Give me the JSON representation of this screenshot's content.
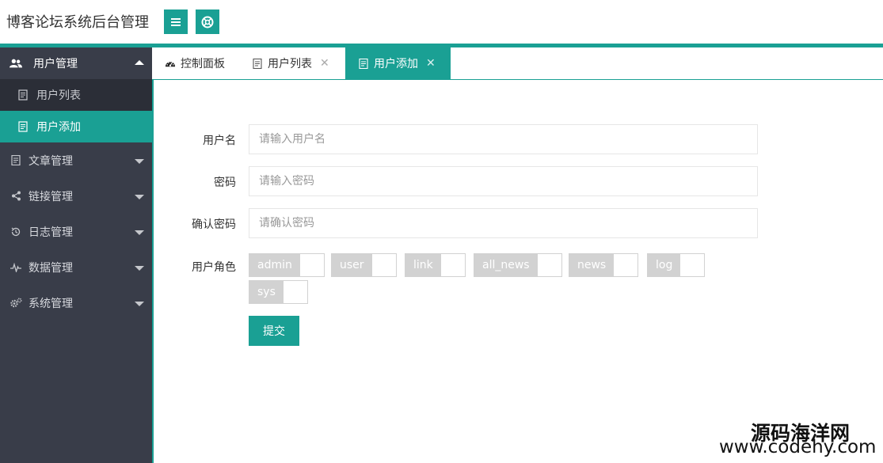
{
  "header": {
    "title": "博客论坛系统后台管理",
    "menu_icon": "menu-icon",
    "help_icon": "lifebuoy-icon"
  },
  "sidebar": {
    "groups": [
      {
        "label": "用户管理",
        "icon": "users-icon",
        "open": true,
        "items": [
          {
            "label": "用户列表",
            "icon": "document-icon",
            "active": false
          },
          {
            "label": "用户添加",
            "icon": "document-icon",
            "active": true
          }
        ]
      },
      {
        "label": "文章管理",
        "icon": "document-icon",
        "open": false
      },
      {
        "label": "链接管理",
        "icon": "share-icon",
        "open": false
      },
      {
        "label": "日志管理",
        "icon": "history-icon",
        "open": false
      },
      {
        "label": "数据管理",
        "icon": "pulse-icon",
        "open": false
      },
      {
        "label": "系统管理",
        "icon": "gears-icon",
        "open": false
      }
    ]
  },
  "tabs": [
    {
      "label": "控制面板",
      "icon": "dashboard-icon",
      "closable": false,
      "active": false
    },
    {
      "label": "用户列表",
      "icon": "document-icon",
      "closable": true,
      "active": false
    },
    {
      "label": "用户添加",
      "icon": "document-icon",
      "closable": true,
      "active": true
    }
  ],
  "tab_close_glyph": "✕",
  "form": {
    "username": {
      "label": "用户名",
      "placeholder": "请输入用户名",
      "value": ""
    },
    "password": {
      "label": "密码",
      "placeholder": "请输入密码",
      "value": ""
    },
    "confirm": {
      "label": "确认密码",
      "placeholder": "请确认密码",
      "value": ""
    },
    "roles_label": "用户角色",
    "roles": [
      "admin",
      "user",
      "link",
      "all_news",
      "news",
      "log",
      "sys"
    ],
    "submit_label": "提交"
  },
  "watermark": {
    "line1": "源码海洋网",
    "line2": "www.codehy.com"
  },
  "colors": {
    "accent": "#1aa094",
    "sidebar_bg": "#393d49",
    "switch_off": "#d2d2d2"
  }
}
